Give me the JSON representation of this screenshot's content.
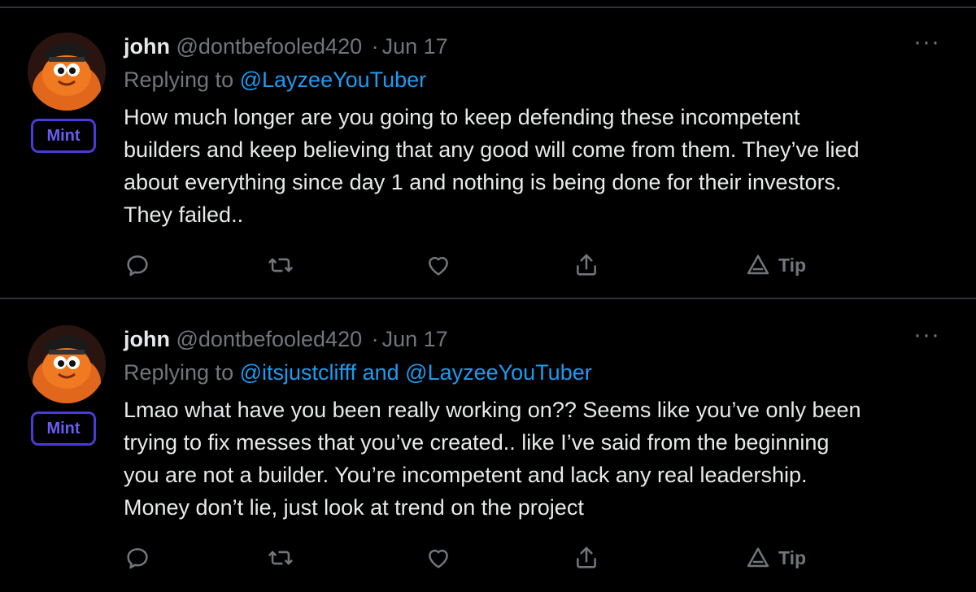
{
  "tweets": [
    {
      "author_name": "john",
      "handle": "@dontbefooled420",
      "separator": "·",
      "date": "Jun 17",
      "badge": "Mint",
      "replying_label": "Replying to",
      "mentions": [
        "@LayzeeYouTuber"
      ],
      "mention_joiner": "",
      "text_lines": [
        "How much longer are you going to keep defending these incompetent",
        "builders and keep believing that any good will come from them. They’ve lied",
        "about everything since day 1 and nothing is being done for their investors.",
        "They failed.."
      ],
      "tip_label": "Tip",
      "more": "···"
    },
    {
      "author_name": "john",
      "handle": "@dontbefooled420",
      "separator": "·",
      "date": "Jun 17",
      "badge": "Mint",
      "replying_label": "Replying to",
      "mentions": [
        "@itsjustclifff",
        "@LayzeeYouTuber"
      ],
      "mention_joiner": "and",
      "text_lines": [
        "Lmao what have you been really working on?? Seems like you’ve only been",
        "trying to fix messes that you’ve created.. like I’ve said from the beginning",
        "you are not a builder. You’re incompetent and lack any real leadership.",
        "Money don’t lie, just look at trend on the project"
      ],
      "tip_label": "Tip",
      "more": "···"
    }
  ],
  "colors": {
    "background": "#000000",
    "text": "#e7e9ea",
    "muted": "#71767b",
    "link": "#1d9bf0",
    "badge": "#4a3ad8",
    "divider": "#2f3336"
  },
  "icons": [
    "reply-icon",
    "retweet-icon",
    "like-icon",
    "share-icon",
    "tip-icon",
    "more-icon"
  ]
}
